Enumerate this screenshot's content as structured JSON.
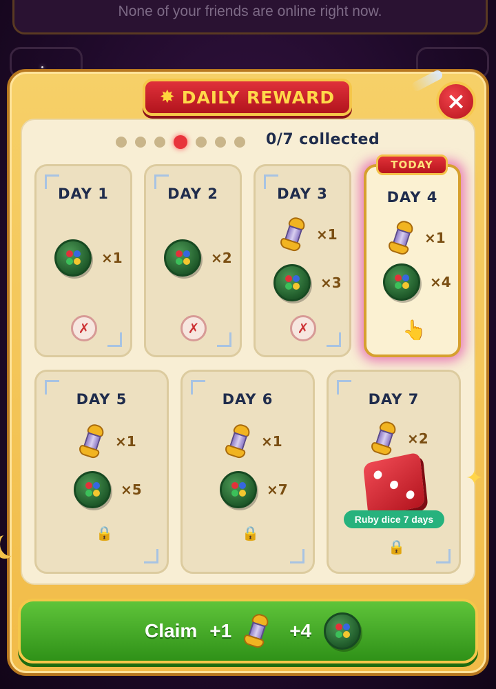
{
  "background": {
    "friends_status": "None of your friends are online right now."
  },
  "header": {
    "title": "DAILY REWARD",
    "star_icon": "star-icon",
    "close_label": "×"
  },
  "progress": {
    "collected_text": "0/7 collected",
    "current_day_index": 4,
    "total_days": 7
  },
  "today_label": "TODAY",
  "days": [
    {
      "label": "DAY 1",
      "rewards": [
        {
          "item": "chip",
          "qty": "×1"
        }
      ],
      "status": "missed"
    },
    {
      "label": "DAY 2",
      "rewards": [
        {
          "item": "chip",
          "qty": "×2"
        }
      ],
      "status": "missed"
    },
    {
      "label": "DAY 3",
      "rewards": [
        {
          "item": "pawn",
          "qty": "×1"
        },
        {
          "item": "chip",
          "qty": "×3"
        }
      ],
      "status": "missed"
    },
    {
      "label": "DAY 4",
      "rewards": [
        {
          "item": "pawn",
          "qty": "×1"
        },
        {
          "item": "chip",
          "qty": "×4"
        }
      ],
      "status": "today"
    },
    {
      "label": "DAY 5",
      "rewards": [
        {
          "item": "pawn",
          "qty": "×1"
        },
        {
          "item": "chip",
          "qty": "×5"
        }
      ],
      "status": "locked"
    },
    {
      "label": "DAY 6",
      "rewards": [
        {
          "item": "pawn",
          "qty": "×1"
        },
        {
          "item": "chip",
          "qty": "×7"
        }
      ],
      "status": "locked"
    },
    {
      "label": "DAY 7",
      "rewards": [
        {
          "item": "pawn",
          "qty": "×2"
        },
        {
          "item": "dice",
          "label": "Ruby dice 7 days"
        }
      ],
      "status": "locked"
    }
  ],
  "status_icons": {
    "missed": "✗",
    "locked": "🔒",
    "today": "👆"
  },
  "claim": {
    "label": "Claim",
    "pawn_qty": "+1",
    "chip_qty": "+4"
  },
  "colors": {
    "panel": "#f1bb48",
    "title_badge": "#c51e27",
    "claim_button": "#3fa324",
    "today_glow": "#dc28a0"
  }
}
